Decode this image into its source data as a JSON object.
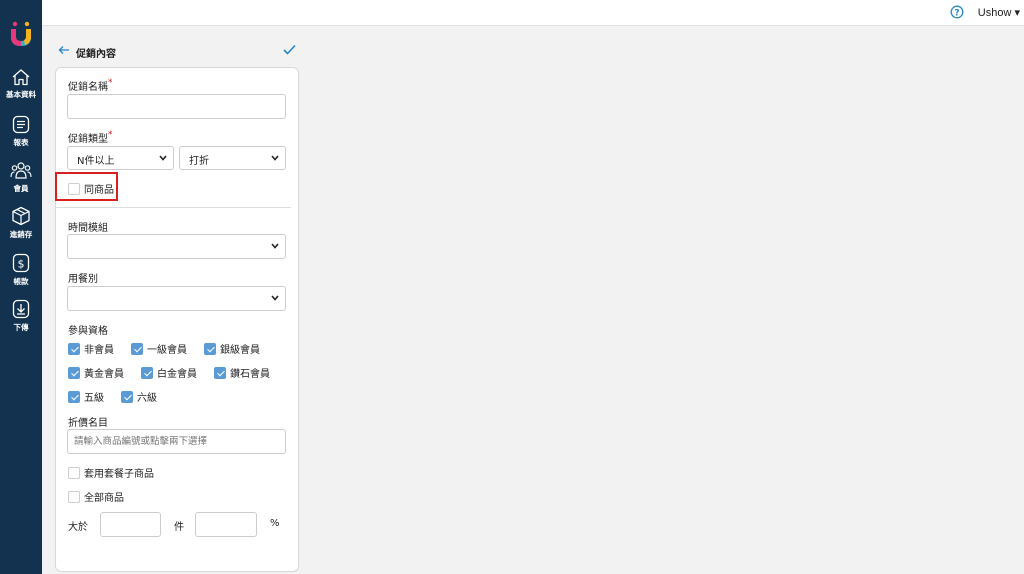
{
  "sidebar": {
    "items": [
      {
        "label": "基本資料",
        "icon": "home-icon"
      },
      {
        "label": "報表",
        "icon": "report-icon"
      },
      {
        "label": "會員",
        "icon": "members-icon"
      },
      {
        "label": "進銷存",
        "icon": "inventory-box-icon"
      },
      {
        "label": "帳款",
        "icon": "dollar-icon"
      },
      {
        "label": "下傳",
        "icon": "download-icon"
      }
    ]
  },
  "topbar": {
    "user": "Ushow ▾"
  },
  "panel": {
    "title": "促銷內容"
  },
  "form": {
    "promo_name": {
      "label": "促銷名稱",
      "required": "*",
      "value": ""
    },
    "promo_type": {
      "label": "促銷類型",
      "required": "*",
      "condition": "N件以上",
      "action": "打折"
    },
    "same_product": {
      "label": "同商品",
      "checked": false
    },
    "time_module": {
      "label": "時間模組",
      "value": ""
    },
    "meal_type": {
      "label": "用餐別",
      "value": ""
    },
    "eligibility": {
      "label": "參與資格",
      "options": [
        {
          "label": "非會員",
          "checked": true
        },
        {
          "label": "一級會員",
          "checked": true
        },
        {
          "label": "銀級會員",
          "checked": true
        },
        {
          "label": "黃金會員",
          "checked": true
        },
        {
          "label": "白金會員",
          "checked": true
        },
        {
          "label": "鑽石會員",
          "checked": true
        },
        {
          "label": "五級",
          "checked": true
        },
        {
          "label": "六級",
          "checked": true
        }
      ]
    },
    "discount_items": {
      "label": "折價名目",
      "placeholder": "請輸入商品編號或點擊兩下選擇"
    },
    "apply_set_meal": {
      "label": "套用套餐子商品",
      "checked": false
    },
    "all_products": {
      "label": "全部商品",
      "checked": false
    },
    "threshold": {
      "greater_than": "大於",
      "unit_items": "件",
      "unit_percent": "%"
    }
  },
  "colors": {
    "sidebar": "#12324f",
    "accent": "#5b9bd5",
    "highlight": "#d8201f"
  }
}
